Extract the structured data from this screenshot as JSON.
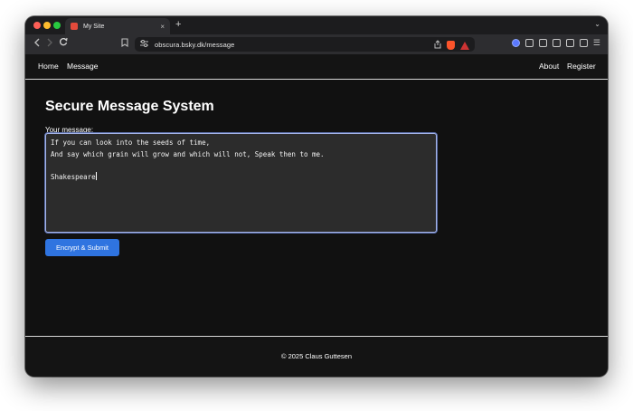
{
  "browser": {
    "tab_title": "My Site",
    "tab_close": "×",
    "new_tab": "+",
    "tab_menu": "⌄",
    "url": "obscura.bsky.dk/message"
  },
  "nav": {
    "home": "Home",
    "message": "Message",
    "about": "About",
    "register": "Register"
  },
  "main": {
    "title": "Secure Message System",
    "message_label": "Your message:",
    "message_value": "If you can look into the seeds of time,\nAnd say which grain will grow and which will not, Speak then to me.\n\nShakespeare",
    "submit_label": "Encrypt & Submit"
  },
  "footer": {
    "copyright": "© 2025 Claus Guttesen"
  },
  "icons": {
    "back": "chevron-left-icon",
    "forward": "chevron-right-icon",
    "reload": "reload-icon",
    "bookmark": "bookmark-icon",
    "site_settings": "site-settings-icon",
    "share": "share-icon",
    "brave_shields": "brave-shield-icon",
    "brave_rewards": "brave-rewards-icon"
  },
  "colors": {
    "accent": "#2f74e0",
    "page_bg": "#111111",
    "focus_border": "#a5b4e8"
  }
}
